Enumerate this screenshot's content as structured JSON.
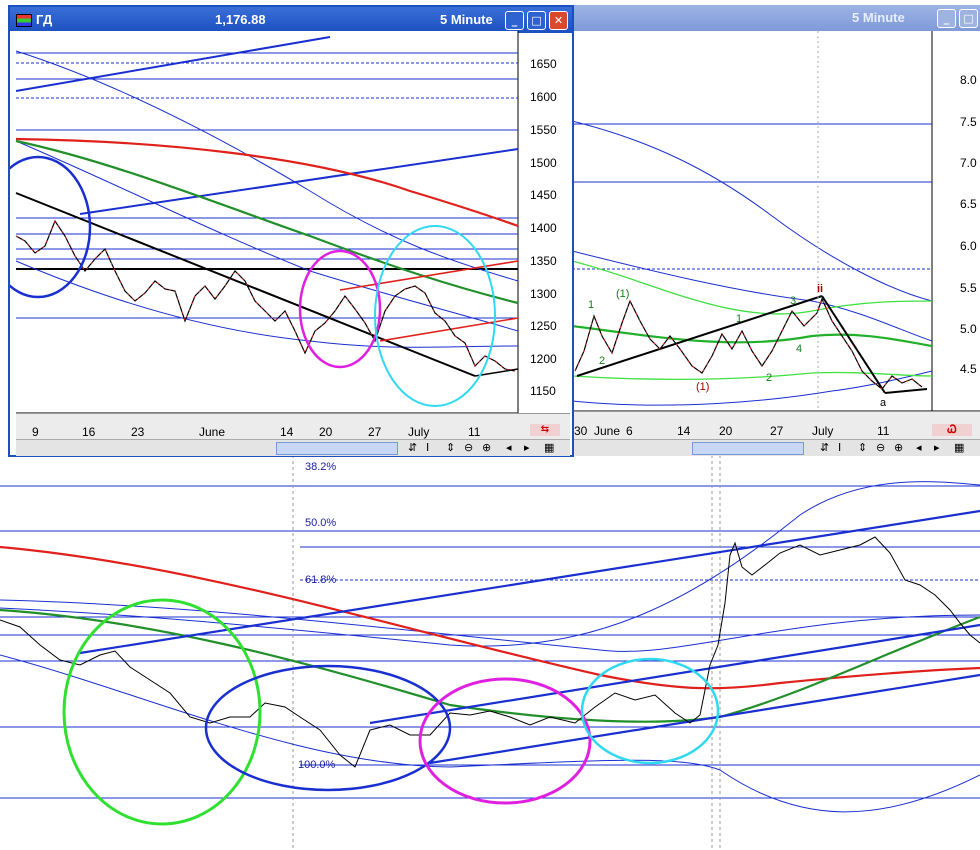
{
  "left_window": {
    "title": "ГД",
    "price": "1,176.88",
    "interval": "5 Minute",
    "y_ticks": [
      "1650",
      "1600",
      "1550",
      "1500",
      "1450",
      "1400",
      "1350",
      "1300",
      "1250",
      "1200",
      "1150"
    ],
    "x_ticks": [
      "9",
      "16",
      "23",
      "June",
      "14",
      "20",
      "27",
      "July",
      "11"
    ],
    "toolbar": [
      "⇵",
      "I",
      "⇕",
      "⊖",
      "⊕",
      "◂",
      "▸",
      "▦"
    ]
  },
  "right_window": {
    "interval": "5 Minute",
    "y_ticks": [
      "8.0",
      "7.5",
      "7.0",
      "6.5",
      "6.0",
      "5.5",
      "5.0",
      "4.5"
    ],
    "x_ticks": [
      "30",
      "June",
      "6",
      "14",
      "20",
      "27",
      "July",
      "11"
    ],
    "wave_labels": [
      "1",
      "2",
      "(1)",
      "(1)",
      "1",
      "2",
      "3",
      "4",
      "ii",
      "a"
    ],
    "toolbar": [
      "⇵",
      "I",
      "⇕",
      "⊖",
      "⊕",
      "◂",
      "▸",
      "▦"
    ]
  },
  "bottom_chart": {
    "fib_levels": [
      "38.2%",
      "50.0%",
      "61.8%",
      "100.0%"
    ]
  },
  "colors": {
    "titlebar_active": "#1c4fc0",
    "titlebar_inactive": "#8aa2dc",
    "trend_blue": "#1a2fd0",
    "ma_red": "#e0201a",
    "ma_green": "#22902a",
    "circle_magenta": "#e020e0",
    "circle_cyan": "#30d8f0",
    "circle_green": "#30e030"
  },
  "chart_data": [
    {
      "type": "line",
      "title": "",
      "y_range": [
        1110,
        1680
      ],
      "x_categories": [
        "9",
        "16",
        "23",
        "June",
        "14",
        "20",
        "27",
        "July",
        "11"
      ],
      "series": [
        {
          "values": [
            1385,
            1372,
            1395,
            1360,
            1330,
            1320,
            1300,
            1280,
            1310,
            1330,
            1295,
            1270,
            1250,
            1235,
            1245,
            1260,
            1230,
            1215,
            1260,
            1290,
            1270,
            1240,
            1300,
            1320,
            1305,
            1270,
            1230,
            1205,
            1195,
            1180
          ]
        }
      ],
      "horizontal_lines": [
        1655,
        1640,
        1625,
        1600,
        1550,
        1410,
        1385,
        1360,
        1345,
        1330,
        1255
      ]
    },
    {
      "type": "line",
      "title": "",
      "y_range": [
        4.0,
        8.4
      ],
      "x_categories": [
        "30",
        "June",
        "6",
        "14",
        "20",
        "27",
        "July",
        "11"
      ],
      "series": [
        {
          "values": [
            4.4,
            4.9,
            5.2,
            4.7,
            5.0,
            5.3,
            5.1,
            4.8,
            4.6,
            4.5,
            4.9,
            5.1,
            4.8,
            4.6,
            5.0,
            5.2,
            5.3,
            5.4,
            5.2,
            4.9,
            4.6,
            4.4,
            4.5,
            4.4,
            4.3
          ]
        }
      ]
    },
    {
      "type": "line",
      "title": "",
      "y_range": [
        0,
        100
      ],
      "series": [
        {
          "values": [
            26,
            28,
            24,
            22,
            20,
            18,
            14,
            13,
            10,
            8,
            6,
            4,
            6,
            8,
            10,
            12,
            14,
            12,
            11,
            12,
            13,
            14,
            13,
            20,
            50,
            62,
            66,
            70,
            64,
            58
          ]
        }
      ]
    }
  ]
}
